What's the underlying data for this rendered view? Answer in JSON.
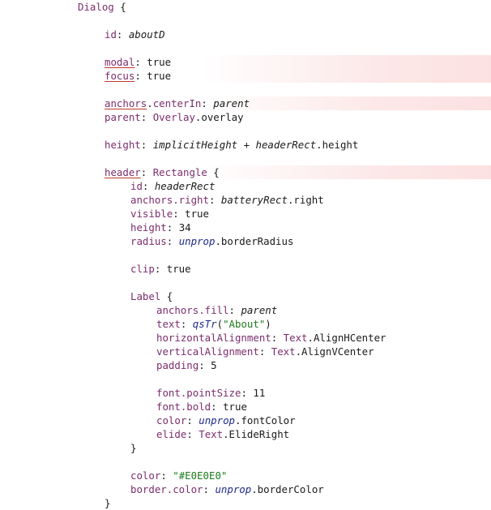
{
  "editor": {
    "lines": [
      {
        "indent": 96,
        "tokens": [
          {
            "t": "Dialog",
            "c": "type"
          },
          {
            "t": " {",
            "c": "plain"
          }
        ]
      },
      {
        "indent": 96,
        "tokens": []
      },
      {
        "indent": 129,
        "tokens": [
          {
            "t": "id",
            "c": "prop"
          },
          {
            "t": ": ",
            "c": "plain"
          },
          {
            "t": "aboutD",
            "c": "ital"
          }
        ]
      },
      {
        "indent": 129,
        "tokens": []
      },
      {
        "indent": 129,
        "warn": true,
        "tokens": [
          {
            "t": "modal",
            "c": "warn"
          },
          {
            "t": ": ",
            "c": "plain"
          },
          {
            "t": "true",
            "c": "val"
          }
        ]
      },
      {
        "indent": 129,
        "warn": true,
        "tokens": [
          {
            "t": "focus",
            "c": "warn"
          },
          {
            "t": ": ",
            "c": "plain"
          },
          {
            "t": "true",
            "c": "val"
          }
        ]
      },
      {
        "indent": 129,
        "tokens": []
      },
      {
        "indent": 129,
        "warn": true,
        "tokens": [
          {
            "t": "anchors",
            "c": "warn"
          },
          {
            "t": ".",
            "c": "plain"
          },
          {
            "t": "centerIn",
            "c": "prop"
          },
          {
            "t": ": ",
            "c": "plain"
          },
          {
            "t": "parent",
            "c": "ital"
          }
        ]
      },
      {
        "indent": 129,
        "tokens": [
          {
            "t": "parent",
            "c": "prop"
          },
          {
            "t": ": ",
            "c": "plain"
          },
          {
            "t": "Overlay",
            "c": "type"
          },
          {
            "t": ".overlay",
            "c": "plain"
          }
        ]
      },
      {
        "indent": 129,
        "tokens": []
      },
      {
        "indent": 129,
        "tokens": [
          {
            "t": "height",
            "c": "prop"
          },
          {
            "t": ": ",
            "c": "plain"
          },
          {
            "t": "implicitHeight",
            "c": "ital"
          },
          {
            "t": " + ",
            "c": "plain"
          },
          {
            "t": "headerRect",
            "c": "ital"
          },
          {
            "t": ".height",
            "c": "plain"
          }
        ]
      },
      {
        "indent": 129,
        "tokens": []
      },
      {
        "indent": 129,
        "warn": true,
        "tokens": [
          {
            "t": "header",
            "c": "warn"
          },
          {
            "t": ": ",
            "c": "plain"
          },
          {
            "t": "Rectangle",
            "c": "type"
          },
          {
            "t": " {",
            "c": "plain"
          }
        ]
      },
      {
        "indent": 161,
        "tokens": [
          {
            "t": "id",
            "c": "prop"
          },
          {
            "t": ": ",
            "c": "plain"
          },
          {
            "t": "headerRect",
            "c": "ital"
          }
        ]
      },
      {
        "indent": 161,
        "tokens": [
          {
            "t": "anchors.right",
            "c": "prop"
          },
          {
            "t": ": ",
            "c": "plain"
          },
          {
            "t": "batteryRect",
            "c": "ital"
          },
          {
            "t": ".right",
            "c": "plain"
          }
        ]
      },
      {
        "indent": 161,
        "tokens": [
          {
            "t": "visible",
            "c": "prop"
          },
          {
            "t": ": ",
            "c": "plain"
          },
          {
            "t": "true",
            "c": "val"
          }
        ]
      },
      {
        "indent": 161,
        "tokens": [
          {
            "t": "height",
            "c": "prop"
          },
          {
            "t": ": ",
            "c": "plain"
          },
          {
            "t": "34",
            "c": "num"
          }
        ]
      },
      {
        "indent": 161,
        "tokens": [
          {
            "t": "radius",
            "c": "prop"
          },
          {
            "t": ": ",
            "c": "plain"
          },
          {
            "t": "unprop",
            "c": "func"
          },
          {
            "t": ".borderRadius",
            "c": "plain"
          }
        ]
      },
      {
        "indent": 161,
        "tokens": []
      },
      {
        "indent": 161,
        "tokens": [
          {
            "t": "clip",
            "c": "prop"
          },
          {
            "t": ": ",
            "c": "plain"
          },
          {
            "t": "true",
            "c": "val"
          }
        ]
      },
      {
        "indent": 161,
        "tokens": []
      },
      {
        "indent": 161,
        "tokens": [
          {
            "t": "Label",
            "c": "type"
          },
          {
            "t": " {",
            "c": "plain"
          }
        ]
      },
      {
        "indent": 193,
        "tokens": [
          {
            "t": "anchors.fill",
            "c": "prop"
          },
          {
            "t": ": ",
            "c": "plain"
          },
          {
            "t": "parent",
            "c": "ital"
          }
        ]
      },
      {
        "indent": 193,
        "tokens": [
          {
            "t": "text",
            "c": "prop"
          },
          {
            "t": ": ",
            "c": "plain"
          },
          {
            "t": "qsTr",
            "c": "func"
          },
          {
            "t": "(",
            "c": "plain"
          },
          {
            "t": "\"About\"",
            "c": "str"
          },
          {
            "t": ")",
            "c": "plain"
          }
        ]
      },
      {
        "indent": 193,
        "tokens": [
          {
            "t": "horizontalAlignment",
            "c": "prop"
          },
          {
            "t": ": ",
            "c": "plain"
          },
          {
            "t": "Text",
            "c": "type"
          },
          {
            "t": ".AlignHCenter",
            "c": "plain"
          }
        ]
      },
      {
        "indent": 193,
        "tokens": [
          {
            "t": "verticalAlignment",
            "c": "prop"
          },
          {
            "t": ": ",
            "c": "plain"
          },
          {
            "t": "Text",
            "c": "type"
          },
          {
            "t": ".AlignVCenter",
            "c": "plain"
          }
        ]
      },
      {
        "indent": 193,
        "tokens": [
          {
            "t": "padding",
            "c": "prop"
          },
          {
            "t": ": ",
            "c": "plain"
          },
          {
            "t": "5",
            "c": "num"
          }
        ]
      },
      {
        "indent": 193,
        "tokens": []
      },
      {
        "indent": 193,
        "tokens": [
          {
            "t": "font.pointSize",
            "c": "prop"
          },
          {
            "t": ": ",
            "c": "plain"
          },
          {
            "t": "11",
            "c": "num"
          }
        ]
      },
      {
        "indent": 193,
        "tokens": [
          {
            "t": "font.bold",
            "c": "prop"
          },
          {
            "t": ": ",
            "c": "plain"
          },
          {
            "t": "true",
            "c": "val"
          }
        ]
      },
      {
        "indent": 193,
        "tokens": [
          {
            "t": "color",
            "c": "prop"
          },
          {
            "t": ": ",
            "c": "plain"
          },
          {
            "t": "unprop",
            "c": "func"
          },
          {
            "t": ".fontColor",
            "c": "plain"
          }
        ]
      },
      {
        "indent": 193,
        "tokens": [
          {
            "t": "elide",
            "c": "prop"
          },
          {
            "t": ": ",
            "c": "plain"
          },
          {
            "t": "Text",
            "c": "type"
          },
          {
            "t": ".ElideRight",
            "c": "plain"
          }
        ]
      },
      {
        "indent": 161,
        "tokens": [
          {
            "t": "}",
            "c": "plain"
          }
        ]
      },
      {
        "indent": 161,
        "tokens": []
      },
      {
        "indent": 161,
        "tokens": [
          {
            "t": "color",
            "c": "prop"
          },
          {
            "t": ": ",
            "c": "plain"
          },
          {
            "t": "\"#E0E0E0\"",
            "c": "str"
          }
        ]
      },
      {
        "indent": 161,
        "tokens": [
          {
            "t": "border.color",
            "c": "prop"
          },
          {
            "t": ": ",
            "c": "plain"
          },
          {
            "t": "unprop",
            "c": "func"
          },
          {
            "t": ".borderColor",
            "c": "plain"
          }
        ]
      },
      {
        "indent": 129,
        "tokens": [
          {
            "t": "}",
            "c": "plain"
          }
        ]
      }
    ]
  }
}
